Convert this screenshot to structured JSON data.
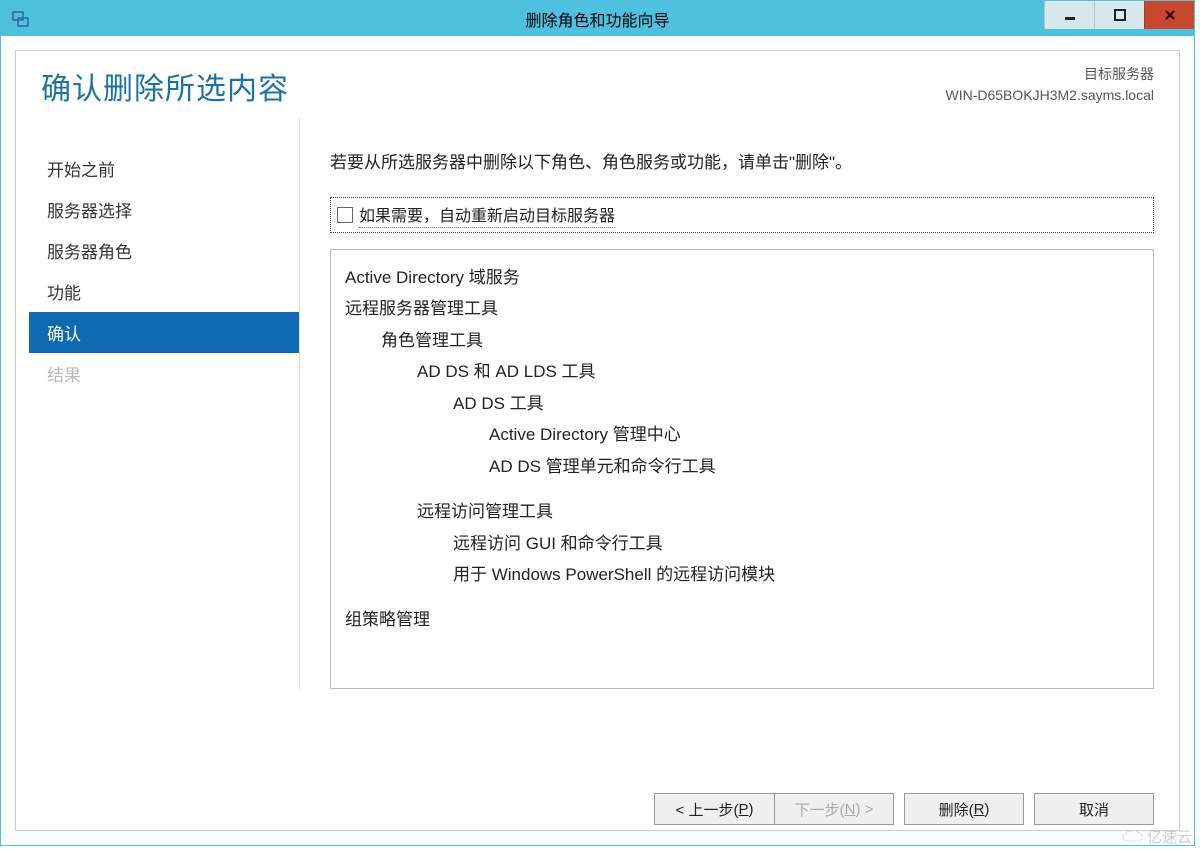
{
  "window": {
    "title": "删除角色和功能向导"
  },
  "header": {
    "page_title": "确认删除所选内容",
    "server_label": "目标服务器",
    "server_name": "WIN-D65BOKJH3M2.sayms.local"
  },
  "nav": {
    "items": [
      {
        "label": "开始之前",
        "state": "normal"
      },
      {
        "label": "服务器选择",
        "state": "normal"
      },
      {
        "label": "服务器角色",
        "state": "normal"
      },
      {
        "label": "功能",
        "state": "normal"
      },
      {
        "label": "确认",
        "state": "active"
      },
      {
        "label": "结果",
        "state": "disabled"
      }
    ]
  },
  "main": {
    "instruction": "若要从所选服务器中删除以下角色、角色服务或功能，请单击\"删除\"。",
    "checkbox": {
      "checked": false,
      "label": "如果需要，自动重新启动目标服务器"
    },
    "features": [
      {
        "level": 0,
        "text": "Active Directory 域服务"
      },
      {
        "level": 0,
        "text": "远程服务器管理工具"
      },
      {
        "level": 1,
        "text": "角色管理工具"
      },
      {
        "level": 2,
        "text": "AD DS 和 AD LDS 工具"
      },
      {
        "level": 3,
        "text": "AD DS 工具"
      },
      {
        "level": 4,
        "text": "Active Directory 管理中心"
      },
      {
        "level": 4,
        "text": "AD DS 管理单元和命令行工具"
      },
      {
        "level": 2,
        "text": "远程访问管理工具",
        "spacer_before": true
      },
      {
        "level": 3,
        "text": "远程访问 GUI 和命令行工具"
      },
      {
        "level": 3,
        "text": "用于 Windows PowerShell 的远程访问模块"
      },
      {
        "level": 0,
        "text": "组策略管理",
        "spacer_before": true
      }
    ]
  },
  "footer": {
    "prev_label": "< 上一步(",
    "prev_hotkey": "P",
    "prev_suffix": ")",
    "next_label": "下一步(",
    "next_hotkey": "N",
    "next_suffix": ") >",
    "remove_label": "删除(",
    "remove_hotkey": "R",
    "remove_suffix": ")",
    "cancel_label": "取消"
  },
  "watermark": "亿速云"
}
